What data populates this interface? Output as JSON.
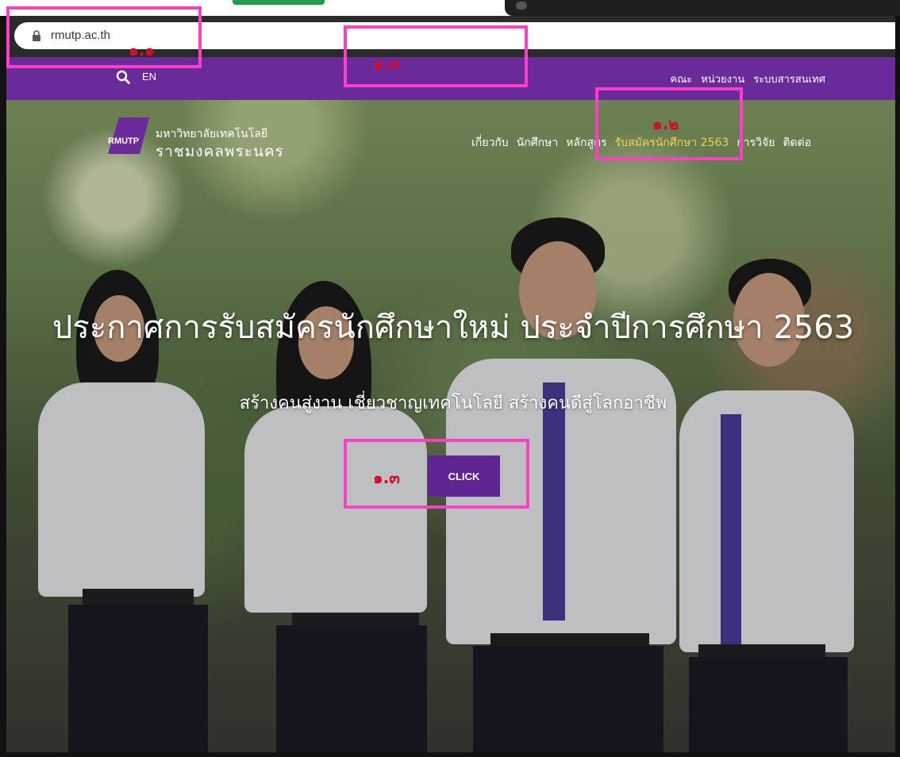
{
  "browser": {
    "url": "rmutp.ac.th"
  },
  "topbar": {
    "lang_label": "EN",
    "util_links": [
      "คณะ",
      "หน่วยงาน",
      "ระบบสารสนเทศ"
    ]
  },
  "logo": {
    "badge": "RMUTP",
    "line1": "มหาวิทยาลัยเทคโนโลยี",
    "line2": "ราชมงคลพระนคร"
  },
  "mainnav": {
    "items": [
      "เกี่ยวกับ",
      "นักศึกษา",
      "หลักสูตร",
      "รับสมัครนักศึกษา 2563",
      "การวิจัย",
      "ติดต่อ"
    ],
    "active_index": 3
  },
  "hero": {
    "headline": "ประกาศการรับสมัครนักศึกษาใหม่ ประจำปีการศึกษา 2563",
    "subline": "สร้างคนสู่งาน เชี่ยวชาญเทคโนโลยี สร้างคนดีสู่โลกอาชีพ",
    "button_label": "CLICK"
  },
  "annotations": {
    "a1": "๑.๑",
    "a2": "๑.๒",
    "a3_top": "๑.๓",
    "a3_button": "๑.๓"
  },
  "colors": {
    "brand_purple": "#6a2a9a",
    "active_nav": "#f1d34a",
    "annotation_box": "#ff40c4",
    "annotation_text": "#d0102a"
  },
  "icons": [
    "lock-icon",
    "search-icon",
    "logo-mark"
  ]
}
